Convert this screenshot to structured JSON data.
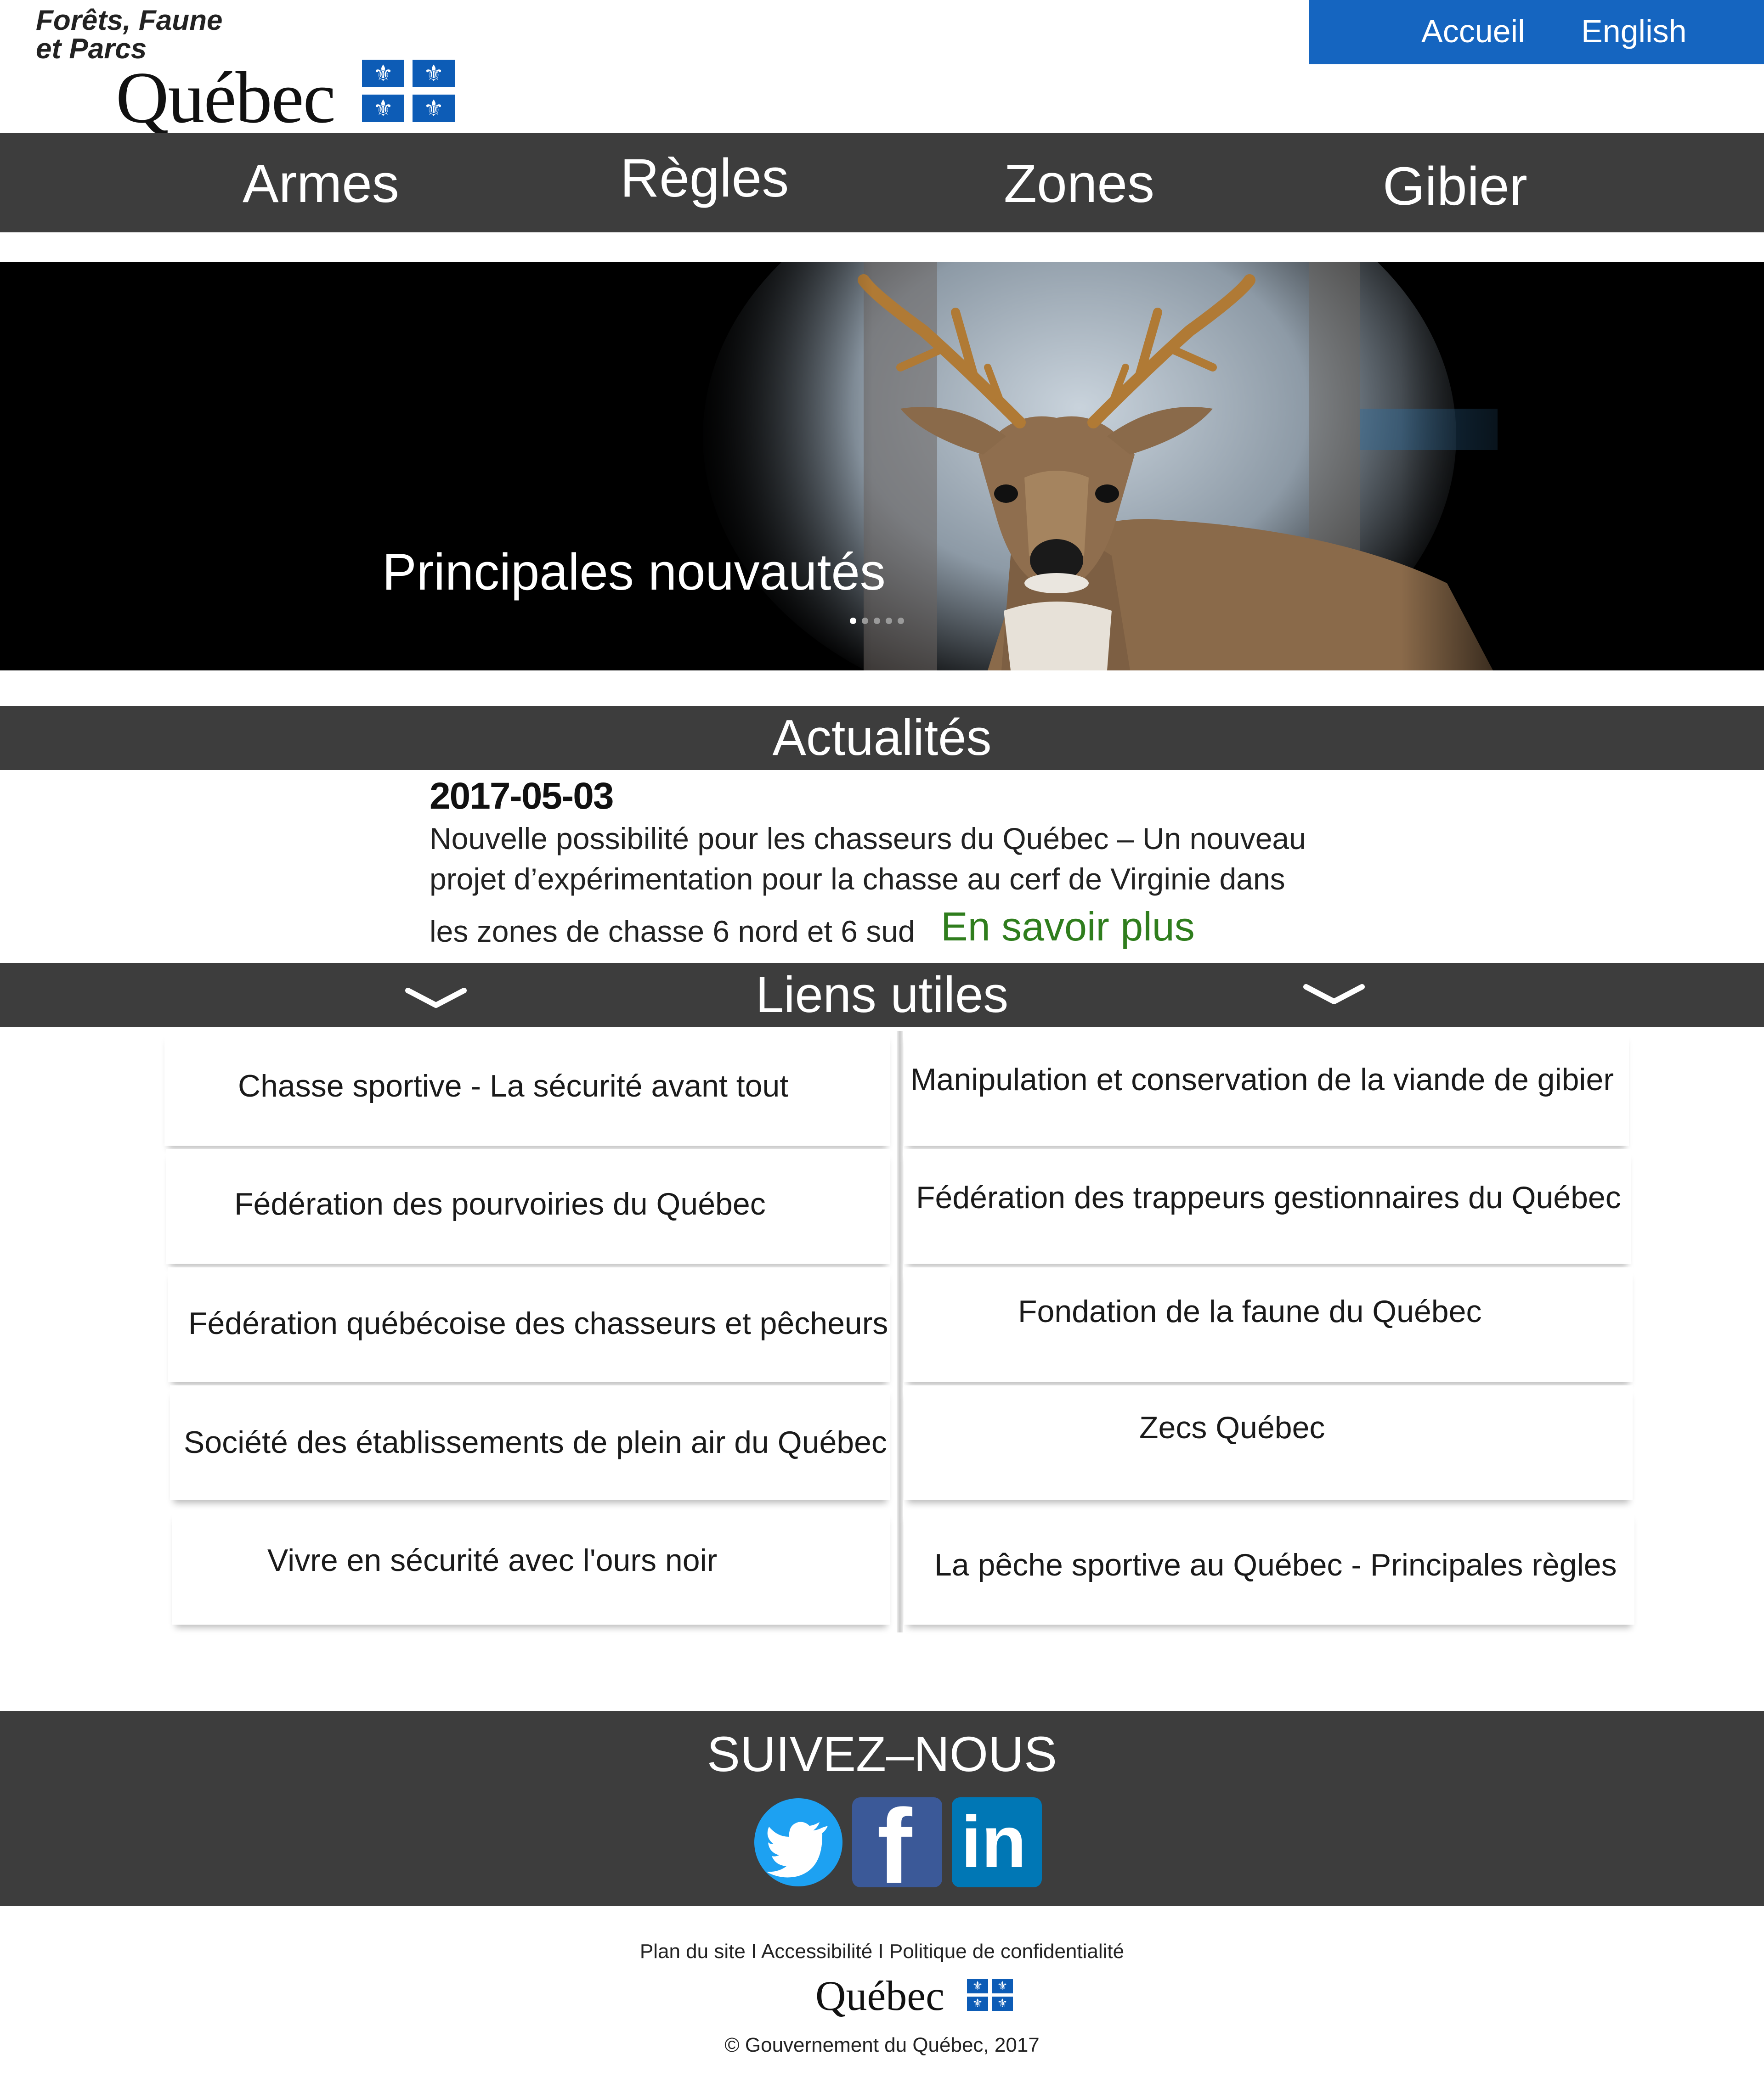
{
  "header": {
    "ministry_line1": "Forêts, Faune",
    "ministry_line2": "et Parcs",
    "logo_word": "Québec",
    "flag_glyph": "⚜",
    "top_nav": [
      "Accueil",
      "English"
    ]
  },
  "main_nav": [
    "Armes",
    "Règles",
    "Zones",
    "Gibier"
  ],
  "hero": {
    "caption": "Principales nouvautés",
    "slides_count": 5,
    "active_slide": 1
  },
  "news": {
    "section_title": "Actualités",
    "date": "2017-05-03",
    "lines": [
      "Nouvelle possibilité pour les chasseurs du Québec – Un nouveau",
      "projet d’expérimentation pour la chasse au cerf de Virginie dans",
      "les zones de chasse 6 nord et 6 sud"
    ],
    "more_label": "En savoir plus"
  },
  "links": {
    "section_title": "Liens utiles",
    "left": [
      "Chasse sportive - La sécurité avant tout",
      "Fédération des pourvoiries du Québec",
      "Fédération québécoise des chasseurs et pêcheurs",
      "Société des établissements de plein air du Québec",
      "Vivre en sécurité avec l'ours noir"
    ],
    "right": [
      "Manipulation et conservation de la viande de gibier",
      "Fédération des trappeurs gestionnaires du Québec",
      "Fondation de la faune du Québec",
      "Zecs Québec",
      "La pêche sportive au Québec - Principales règles"
    ]
  },
  "follow": {
    "title": "SUIVEZ–NOUS",
    "networks": [
      "twitter-icon",
      "facebook-icon",
      "linkedin-icon"
    ],
    "linkedin_text": "in",
    "facebook_text": "f"
  },
  "footer": {
    "links": [
      "Plan du site",
      "Accessibilité",
      "Politique de confidentialité"
    ],
    "separator": " I ",
    "logo_word": "Québec",
    "copyright": "© Gouvernement du Québec, 2017"
  },
  "colors": {
    "top_nav_bg": "#1565c0",
    "bar_bg": "#3d3d3d",
    "link_green": "#2f7d1d",
    "flag_blue": "#0d5cb6",
    "twitter": "#1da1f2",
    "facebook": "#3b5998",
    "linkedin": "#0077b5"
  }
}
